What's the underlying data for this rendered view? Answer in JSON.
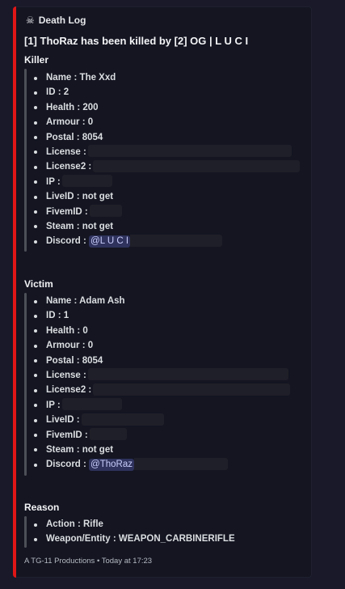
{
  "embed": {
    "accent_color": "#e01616",
    "author_icon": "skull-icon",
    "author": "Death Log",
    "title": "[1] ThoRaz has been killed by [2] OG | L U C I",
    "footer": "A TG-11 Productions • Today at 17:23"
  },
  "killer": {
    "heading": "Killer",
    "name": "Name : The Xxd",
    "id": "ID : 2",
    "health": "Health : 200",
    "armour": "Armour : 0",
    "postal": "Postal : 8054",
    "license": "License :",
    "license2": "License2 :",
    "ip": "IP :",
    "liveid": "LiveID : not get",
    "fivemid": "FivemID :",
    "steam": "Steam : not get",
    "discord_label": "Discord :",
    "discord_mention": "@L U C I"
  },
  "victim": {
    "heading": "Victim",
    "name": "Name : Adam Ash",
    "id": "ID : 1",
    "health": "Health : 0",
    "armour": "Armour : 0",
    "postal": "Postal : 8054",
    "license": "License :",
    "license2": "License2 :",
    "ip": "IP :",
    "liveid": "LiveID :",
    "fivemid": "FivemID :",
    "steam": "Steam : not get",
    "discord_label": "Discord :",
    "discord_mention": "@ThoRaz"
  },
  "reason": {
    "heading": "Reason",
    "action": "Action : Rifle",
    "weapon": "Weapon/Entity : WEAPON_CARBINERIFLE"
  }
}
